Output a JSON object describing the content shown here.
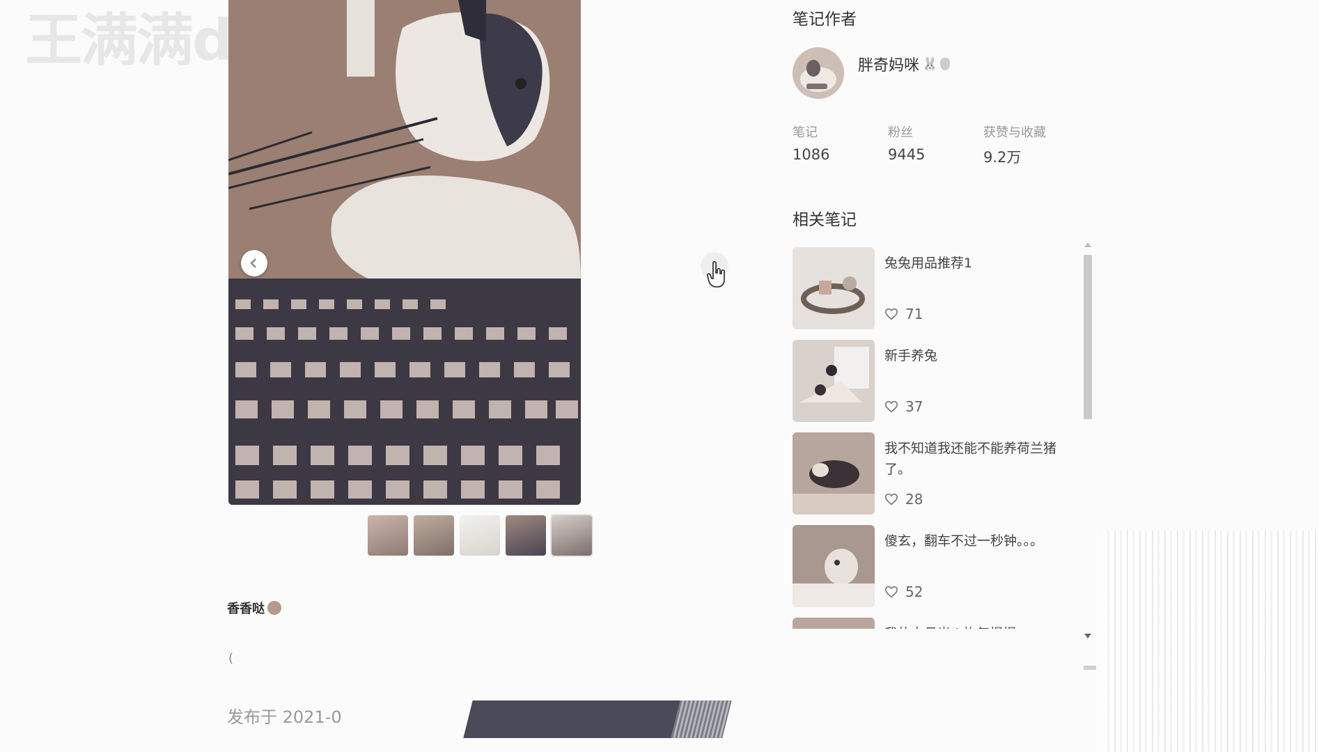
{
  "watermark": "王满满de视频",
  "note": {
    "caption": "香香哒",
    "back_mark": "(",
    "publish": "发布于 2021-0",
    "thumbnail_count": 5
  },
  "author": {
    "section_title": "笔记作者",
    "name": "胖奇妈咪",
    "stats": [
      {
        "label": "笔记",
        "value": "1086"
      },
      {
        "label": "粉丝",
        "value": "9445"
      },
      {
        "label": "获赞与收藏",
        "value": "9.2万"
      }
    ]
  },
  "related": {
    "section_title": "相关笔记",
    "items": [
      {
        "title": "兔兔用品推荐1",
        "likes": "71"
      },
      {
        "title": "新手养兔",
        "likes": "37"
      },
      {
        "title": "我不知道我还能不能养荷兰猪了。",
        "likes": "28"
      },
      {
        "title": "傻玄，翻车不过一秒钟。。。",
        "likes": "52"
      },
      {
        "title": "我的白月光 | 恢复慢慢",
        "likes": ""
      }
    ]
  },
  "icons": {
    "prev": "chevron-left-icon",
    "next": "chevron-right-icon",
    "like": "heart-icon",
    "cursor": "hand-pointer-icon"
  },
  "colors": {
    "background": "#fbfbfb",
    "text": "#333333",
    "muted": "#999999"
  }
}
